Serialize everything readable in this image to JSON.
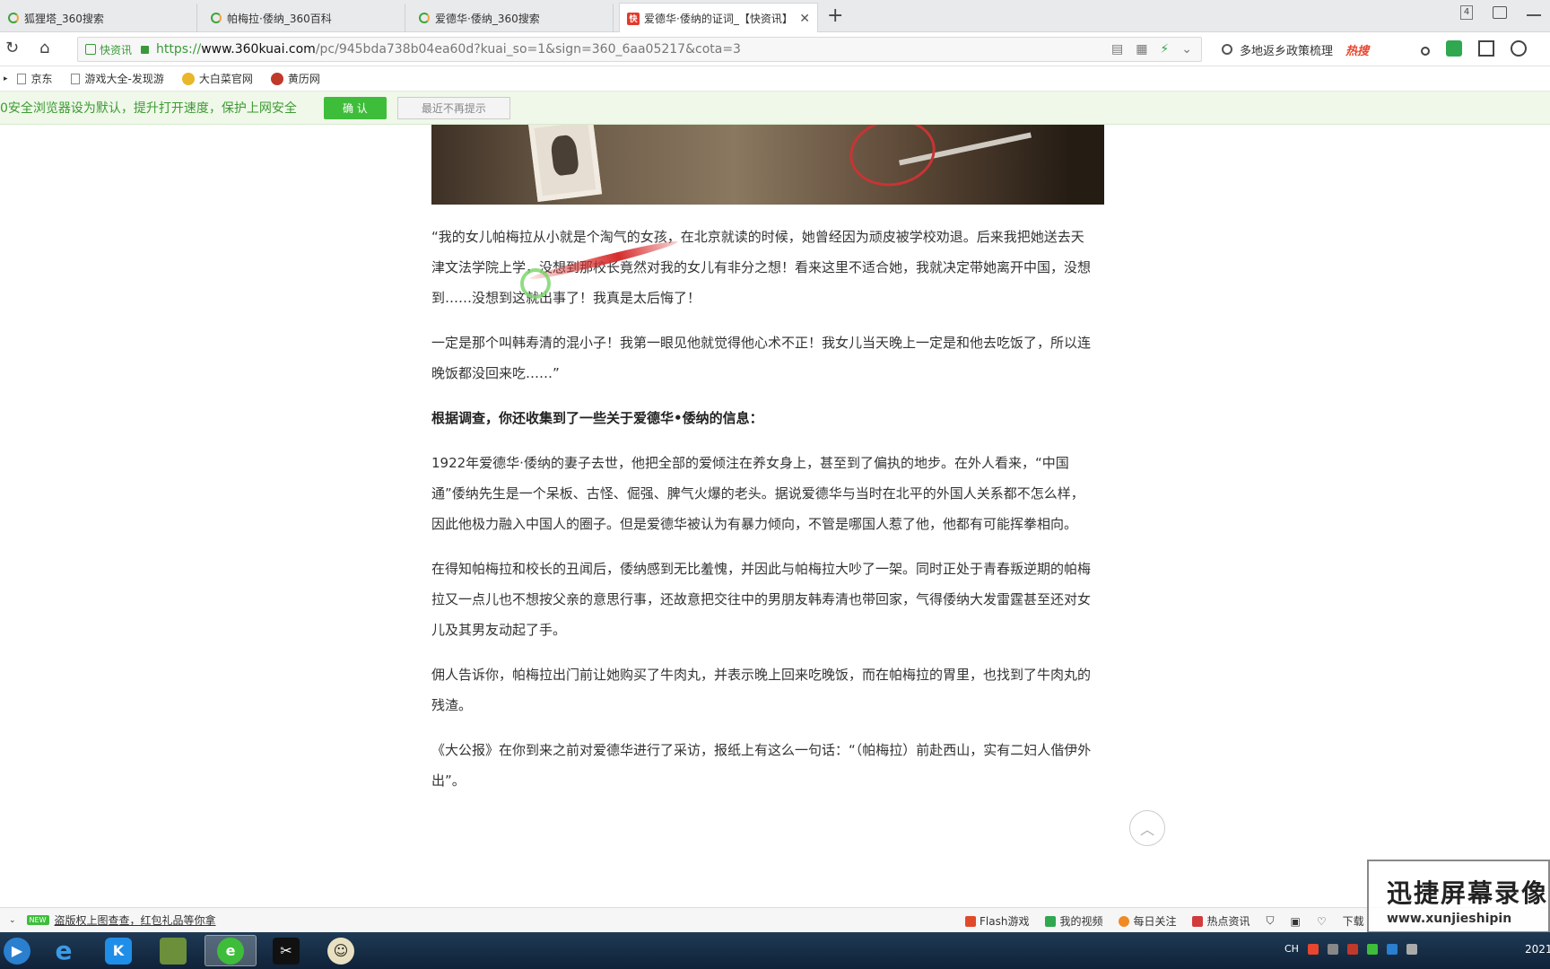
{
  "tabs": [
    {
      "title": "狐狸塔_360搜索",
      "icon": "360-search-icon"
    },
    {
      "title": "帕梅拉·倭纳_360百科",
      "icon": "360-search-icon"
    },
    {
      "title": "爱德华·倭纳_360搜索",
      "icon": "360-search-icon"
    },
    {
      "title": "爱德华·倭纳的证词_【快资讯】",
      "icon": "kuaizixun-icon",
      "active": true
    }
  ],
  "tab_count": "4",
  "address": {
    "site_badge": "快资讯",
    "scheme": "https://",
    "host": "www.360kuai.com",
    "path": "/pc/945bda738b04ea60d?kuai_so=1&sign=360_6aa05217&cota=3"
  },
  "search": {
    "text": "多地返乡政策梳理",
    "hot_label": "热搜"
  },
  "bookmarks": [
    "京东",
    "游戏大全-发现游",
    "大白菜官网",
    "黄历网"
  ],
  "notice": {
    "message": "0安全浏览器设为默认，提升打开速度，保护上网安全",
    "confirm_label": "确 认",
    "dismiss_label": "最近不再提示"
  },
  "article": {
    "paragraphs": [
      "“我的女儿帕梅拉从小就是个淘气的女孩，在北京就读的时候，她曾经因为顽皮被学校劝退。后来我把她送去天津文法学院上学，没想到那校长竟然对我的女儿有非分之想！看来这里不适合她，我就决定带她离开中国，没想到……没想到这就出事了！我真是太后悔了！",
      " 一定是那个叫韩寿清的混小子！我第一眼见他就觉得他心术不正！我女儿当天晚上一定是和他去吃饭了，所以连晚饭都没回来吃……”",
      "根据调查，你还收集到了一些关于爱德华•倭纳的信息：",
      "1922年爱德华·倭纳的妻子去世，他把全部的爱倾注在养女身上，甚至到了偏执的地步。在外人看来，“中国通”倭纳先生是一个呆板、古怪、倔强、脾气火爆的老头。据说爱德华与当时在北平的外国人关系都不怎么样，因此他极力融入中国人的圈子。但是爱德华被认为有暴力倾向，不管是哪国人惹了他，他都有可能挥拳相向。",
      "在得知帕梅拉和校长的丑闻后，倭纳感到无比羞愧，并因此与帕梅拉大吵了一架。同时正处于青春叛逆期的帕梅拉又一点儿也不想按父亲的意思行事，还故意把交往中的男朋友韩寿清也带回家，气得倭纳大发雷霆甚至还对女儿及其男友动起了手。",
      "佣人告诉你，帕梅拉出门前让她购买了牛肉丸，并表示晚上回来吃晚饭，而在帕梅拉的胃里，也找到了牛肉丸的残渣。",
      "《大公报》在你到来之前对爱德华进行了采访，报纸上有这么一句话：“（帕梅拉）前赴西山，实有二妇人偕伊外出”。"
    ]
  },
  "statusbar": {
    "badge": "NEW",
    "news": "盗版权上图查查，红包礼品等你拿",
    "items": [
      "Flash游戏",
      "我的视频",
      "每日关注",
      "热点资讯"
    ],
    "download": "下载"
  },
  "watermark": {
    "title": "迅捷屏幕录像",
    "url": "www.xunjieshipin"
  },
  "taskbar": {
    "apps": [
      "start-icon",
      "ie-icon",
      "kugou-icon",
      "minecraft-icon",
      "360-browser-icon",
      "capcut-icon",
      "qq-icon"
    ]
  },
  "tray": {
    "lang": "CH",
    "clock": "2021"
  },
  "colors": {
    "accent_green": "#3ebd3a",
    "notice_text": "#3d9a33",
    "hot_red": "#e8462e"
  }
}
